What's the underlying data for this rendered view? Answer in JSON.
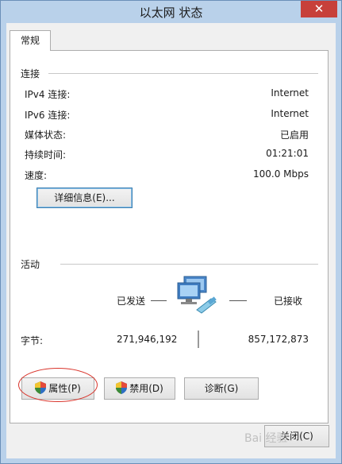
{
  "window": {
    "title": "以太网 状态",
    "close_glyph": "✕"
  },
  "tab": {
    "label": "常规"
  },
  "connection": {
    "group_label": "连接",
    "rows": [
      {
        "label": "IPv4 连接:",
        "value": "Internet"
      },
      {
        "label": "IPv6 连接:",
        "value": "Internet"
      },
      {
        "label": "媒体状态:",
        "value": "已启用"
      },
      {
        "label": "持续时间:",
        "value": "01:21:01"
      },
      {
        "label": "速度:",
        "value": "100.0 Mbps"
      }
    ],
    "details_button": "详细信息(E)..."
  },
  "activity": {
    "group_label": "活动",
    "sent_label": "已发送",
    "received_label": "已接收",
    "bytes_label": "字节:",
    "bytes_sent": "271,946,192",
    "bytes_received": "857,172,873"
  },
  "buttons": {
    "properties": "属性(P)",
    "disable": "禁用(D)",
    "diagnose": "诊断(G)",
    "close": "关闭(C)"
  },
  "watermark": "Bai 经验"
}
